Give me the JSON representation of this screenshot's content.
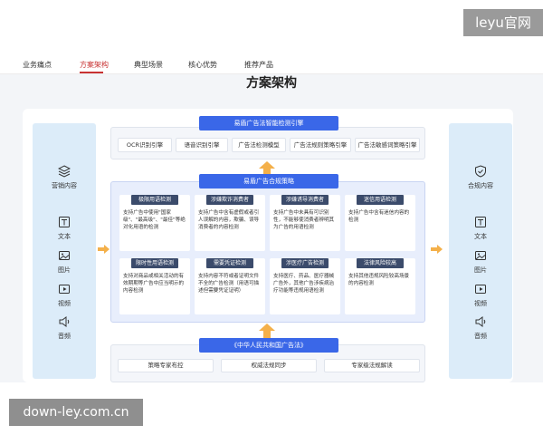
{
  "watermarks": {
    "top": "leyu官网",
    "bottom": "down-ley.com.cn"
  },
  "nav": {
    "tabs": [
      {
        "label": "业务痛点",
        "active": false
      },
      {
        "label": "方案架构",
        "active": true
      },
      {
        "label": "典型场景",
        "active": false
      },
      {
        "label": "核心优势",
        "active": false
      },
      {
        "label": "推荐产品",
        "active": false
      }
    ]
  },
  "page_title": "方案架构",
  "left_column": {
    "items": [
      {
        "label": "营销内容",
        "icon": "layers-icon"
      },
      {
        "label": "文本",
        "icon": "text-icon"
      },
      {
        "label": "图片",
        "icon": "image-icon"
      },
      {
        "label": "视频",
        "icon": "video-icon"
      },
      {
        "label": "音频",
        "icon": "audio-icon"
      }
    ]
  },
  "right_column": {
    "items": [
      {
        "label": "合规内容",
        "icon": "shield-icon"
      },
      {
        "label": "文本",
        "icon": "text-icon"
      },
      {
        "label": "图片",
        "icon": "image-icon"
      },
      {
        "label": "视频",
        "icon": "video-icon"
      },
      {
        "label": "音频",
        "icon": "audio-icon"
      }
    ]
  },
  "engine": {
    "title": "易盾广告法智能检测引擎",
    "chips": [
      "OCR识别引擎",
      "语音识别引擎",
      "广告法检测模型",
      "广告法规则策略引擎",
      "广告法敏感词策略引擎"
    ]
  },
  "strategy": {
    "title": "易盾广告合规策略",
    "cards": [
      {
        "title": "极限用语检测",
        "body": "支持广告中使用\"国家级\"、\"最高级\"、\"最佳\"等绝对化用语的检测"
      },
      {
        "title": "涉嫌欺诈消费者",
        "body": "支持广告中含有虚假或者引人误解的内容，欺骗、误导消费者的内容检测"
      },
      {
        "title": "涉嫌诱导消费者",
        "body": "支持广告中未具有可识别性，不能够使消费者辨明其为广告的用语检测"
      },
      {
        "title": "迷信用语检测",
        "body": "支持广告中含有迷信内容的检测"
      },
      {
        "title": "限时性用语检测",
        "body": "支持对商品或相关活动的有效期期等广告中应当明示的内容检测"
      },
      {
        "title": "需要凭证检测",
        "body": "支持内容不符或者证明文件不全的广告检测（用语可描述但需要凭证证明）"
      },
      {
        "title": "涉医疗广告检测",
        "body": "支持医疗、药品、医疗器械广告外，其他广告涉疾病治疗功能等违规用语检测"
      },
      {
        "title": "法律风险较高",
        "body": "支持其他违规风险较高场景的内容检测"
      }
    ]
  },
  "law": {
    "title": "《中华人民共和国广告法》",
    "chips": [
      "策略专家布控",
      "权威法规同步",
      "专家级法规解读"
    ]
  },
  "colors": {
    "accent_red": "#c83232",
    "header_blue": "#3a67e8",
    "card_head": "#3b4b6b",
    "arrow_orange": "#f4b04a"
  }
}
